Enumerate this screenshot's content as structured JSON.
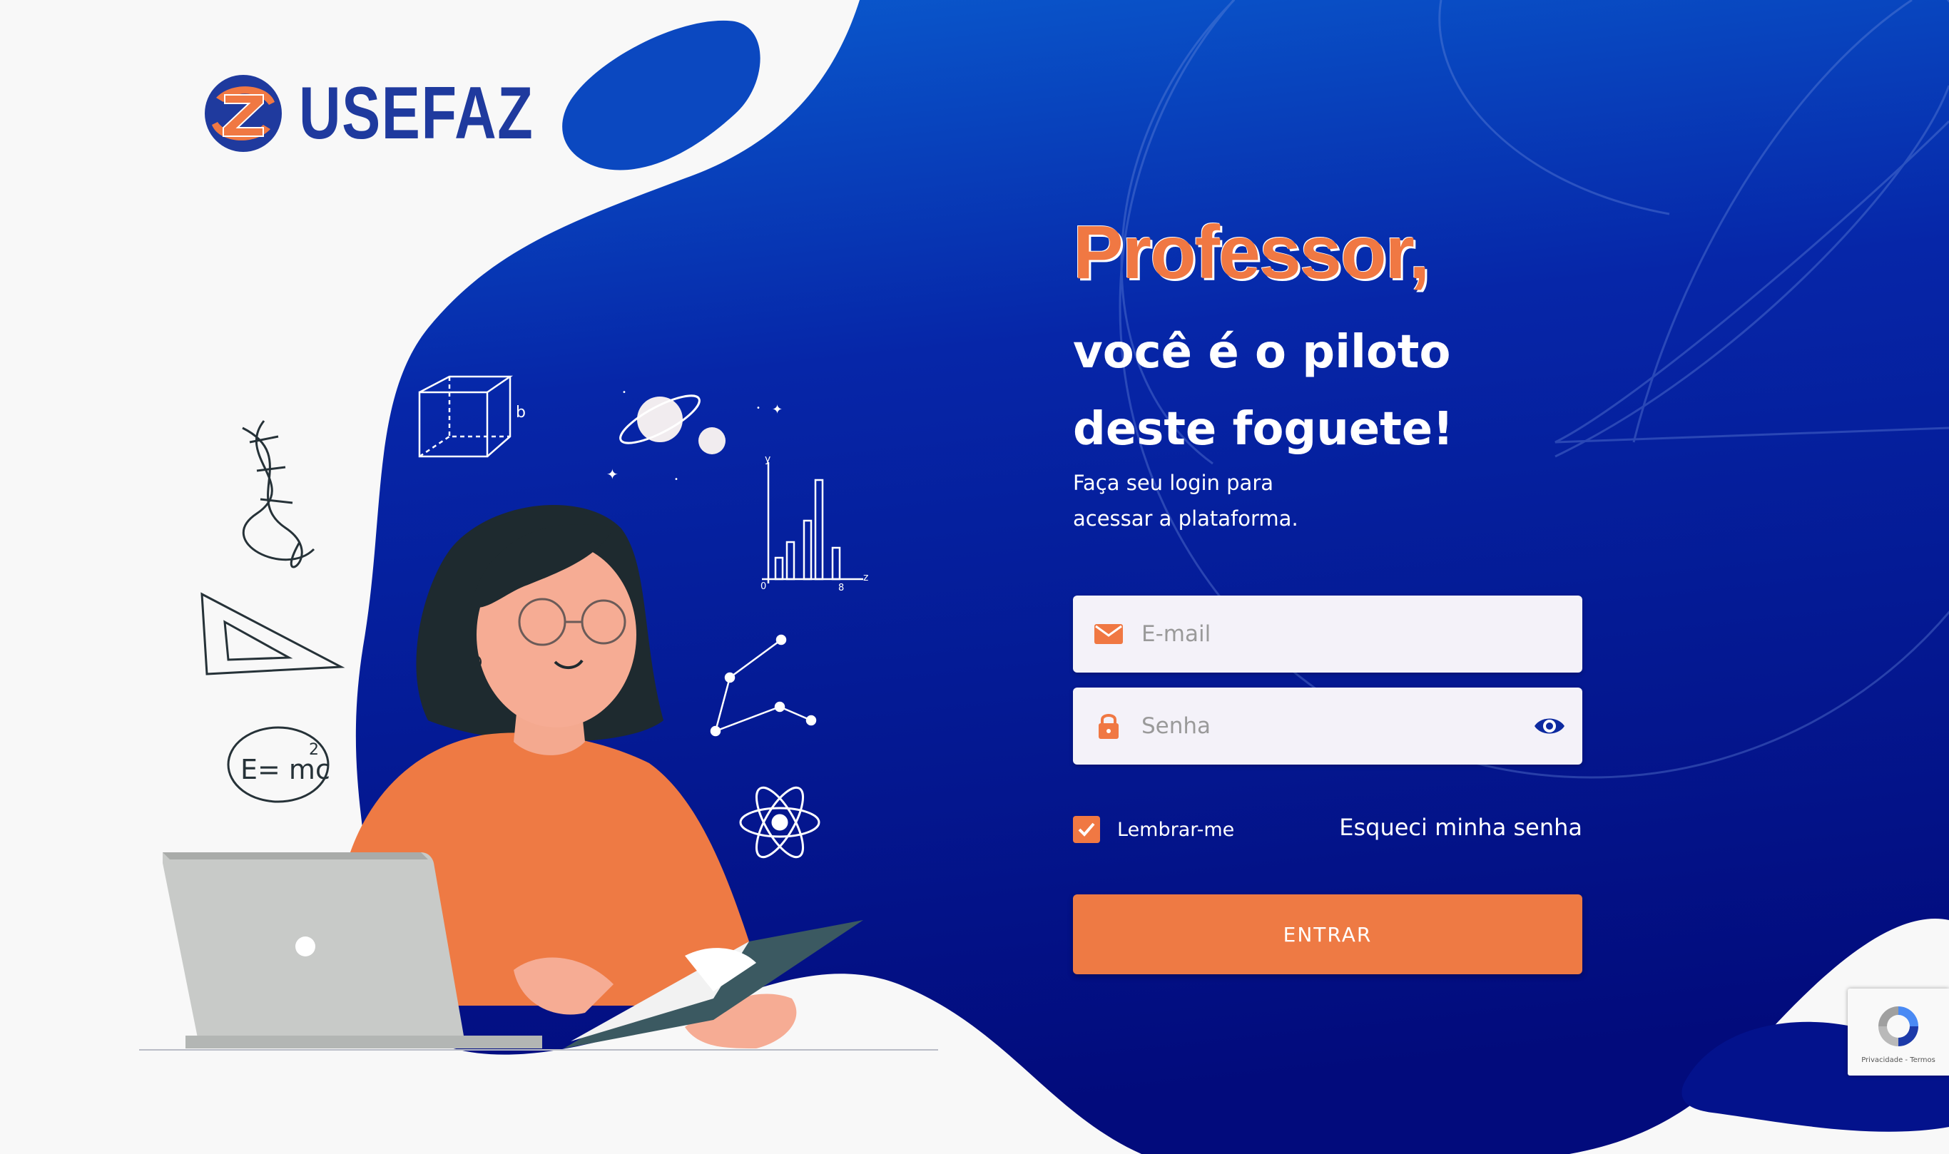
{
  "brand": {
    "name": "USEFAZ",
    "logo_letter": "Z"
  },
  "hero": {
    "title": "Professor,",
    "subtitle_line1": "você é o piloto",
    "subtitle_line2": "deste foguete!",
    "intro_line1": "Faça seu login para",
    "intro_line2": "acessar a plataforma."
  },
  "illustration": {
    "formula": "E= mc",
    "formula_exponent": "2",
    "cube_label": "b",
    "chart_axis_y": "y",
    "chart_axis_x": "z",
    "chart_origin": "0",
    "chart_x_end": "8"
  },
  "form": {
    "email_placeholder": "E-mail",
    "email_value": "",
    "password_placeholder": "Senha",
    "password_value": "",
    "remember_label": "Lembrar-me",
    "remember_checked": true,
    "forgot_label": "Esqueci minha senha",
    "submit_label": "ENTRAR"
  },
  "recaptcha": {
    "links": "Privacidade - Termos"
  },
  "colors": {
    "accent": "#f07843",
    "brand_blue": "#1f3a9e",
    "panel_blue_top": "#0a55c8",
    "panel_blue_bottom": "#030f82"
  },
  "icons": [
    "logo-z-icon",
    "mail-icon",
    "lock-icon",
    "eye-icon",
    "check-icon",
    "recaptcha-icon"
  ]
}
